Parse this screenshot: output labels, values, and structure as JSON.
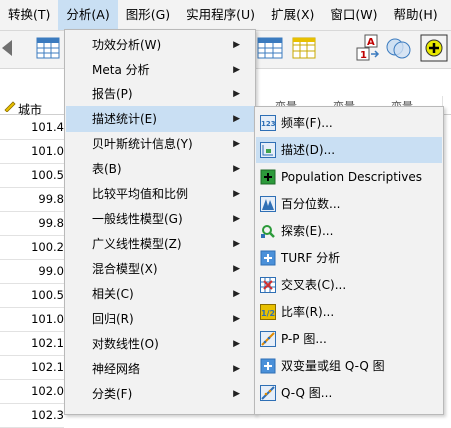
{
  "menubar": {
    "items": [
      {
        "label": "转换(T)",
        "active": false
      },
      {
        "label": "分析(A)",
        "active": true
      },
      {
        "label": "图形(G)",
        "active": false
      },
      {
        "label": "实用程序(U)",
        "active": false
      },
      {
        "label": "扩展(X)",
        "active": false
      },
      {
        "label": "窗口(W)",
        "active": false
      },
      {
        "label": "帮助(H)",
        "active": false
      }
    ]
  },
  "grid": {
    "city_header": "城市",
    "var_header": "变量",
    "values": [
      "101.4",
      "101.0",
      "100.5",
      "99.8",
      "99.8",
      "100.2",
      "99.0",
      "100.5",
      "101.0",
      "102.1",
      "102.1",
      "102.0",
      "102.3"
    ]
  },
  "analyze_menu": {
    "items": [
      {
        "label": "功效分析(W)",
        "submenu": true
      },
      {
        "label": "Meta 分析",
        "submenu": true
      },
      {
        "label": "报告(P)",
        "submenu": true
      },
      {
        "label": "描述统计(E)",
        "submenu": true,
        "highlighted": true
      },
      {
        "label": "贝叶斯统计信息(Y)",
        "submenu": true
      },
      {
        "label": "表(B)",
        "submenu": true
      },
      {
        "label": "比较平均值和比例",
        "submenu": true
      },
      {
        "label": "一般线性模型(G)",
        "submenu": true
      },
      {
        "label": "广义线性模型(Z)",
        "submenu": true
      },
      {
        "label": "混合模型(X)",
        "submenu": true
      },
      {
        "label": "相关(C)",
        "submenu": true
      },
      {
        "label": "回归(R)",
        "submenu": true
      },
      {
        "label": "对数线性(O)",
        "submenu": true
      },
      {
        "label": "神经网络",
        "submenu": true
      },
      {
        "label": "分类(F)",
        "submenu": true
      }
    ]
  },
  "descriptives_menu": {
    "items": [
      {
        "label": "频率(F)...",
        "icon": "frequencies-icon",
        "highlighted": false
      },
      {
        "label": "描述(D)...",
        "icon": "descriptives-icon",
        "highlighted": true
      },
      {
        "label": "Population Descriptives",
        "icon": "population-descriptives-icon",
        "highlighted": false
      },
      {
        "label": "百分位数...",
        "icon": "percentiles-icon",
        "highlighted": false
      },
      {
        "label": "探索(E)...",
        "icon": "explore-icon",
        "highlighted": false
      },
      {
        "label": "TURF 分析",
        "icon": "turf-icon",
        "highlighted": false
      },
      {
        "label": "交叉表(C)...",
        "icon": "crosstabs-icon",
        "highlighted": false
      },
      {
        "label": "比率(R)...",
        "icon": "ratio-icon",
        "highlighted": false
      },
      {
        "label": "P-P 图...",
        "icon": "pp-plot-icon",
        "highlighted": false
      },
      {
        "label": "双变量或组 Q-Q 图",
        "icon": "bivariate-qq-icon",
        "highlighted": false
      },
      {
        "label": "Q-Q 图...",
        "icon": "qq-plot-icon",
        "highlighted": false
      }
    ]
  },
  "colors": {
    "highlight": "#c9dff3",
    "menu_bg": "#f2f2f2",
    "accent_blue": "#2e6fb5"
  }
}
